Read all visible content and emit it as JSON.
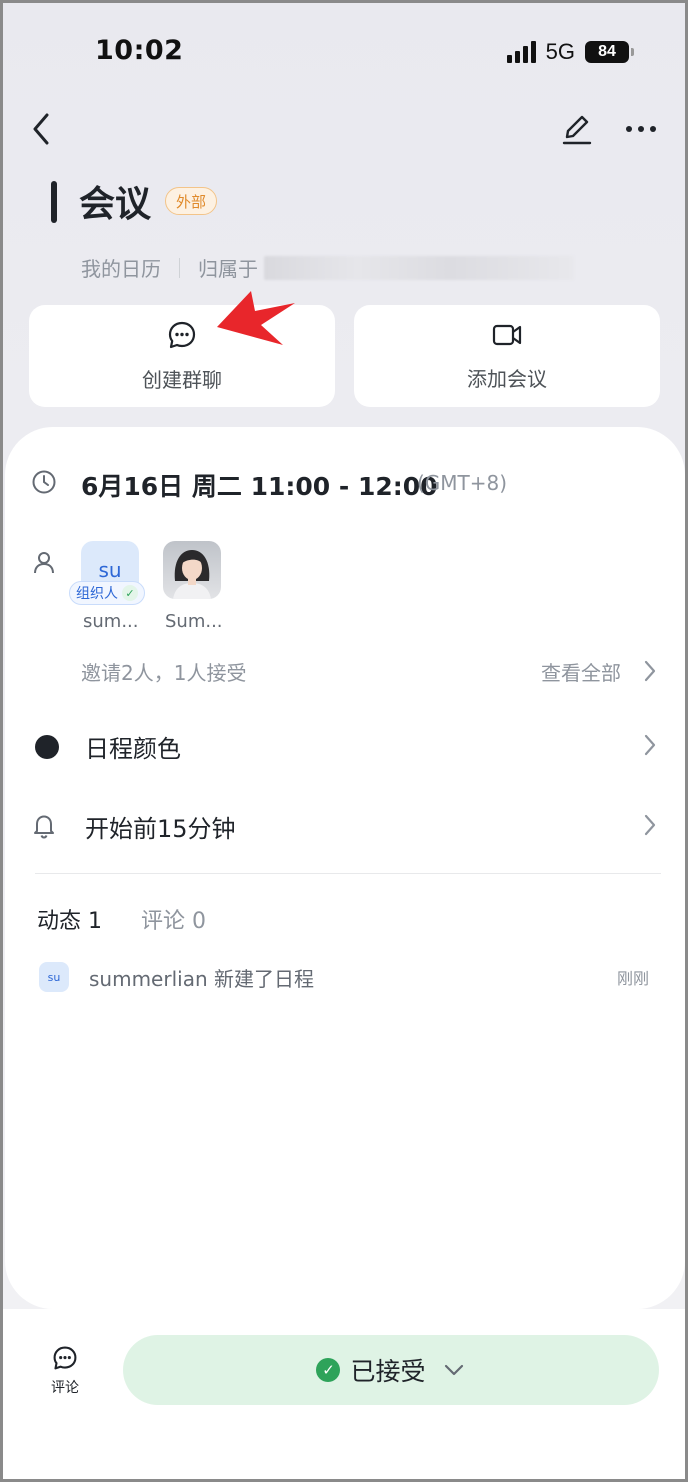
{
  "status_bar": {
    "time": "10:02",
    "network": "5G",
    "battery": "84"
  },
  "event": {
    "title": "会议",
    "external_tag": "外部",
    "calendar_name": "我的日历",
    "owner_label": "归属于"
  },
  "actions": {
    "create_group_chat": "创建群聊",
    "add_meeting": "添加会议"
  },
  "details": {
    "datetime": "6月16日 周二 11:00 - 12:00",
    "timezone": "(GMT+8)",
    "attendees": [
      {
        "avatar_text": "su",
        "name": "sum...",
        "badge": "组织人"
      },
      {
        "avatar_text": "",
        "name": "Sum..."
      }
    ],
    "invite_summary": "邀请2人，1人接受",
    "view_all": "查看全部",
    "color_label": "日程颜色",
    "reminder_label": "开始前15分钟"
  },
  "activity": {
    "tab_activity": "动态 1",
    "tab_comments": "评论 0",
    "items": [
      {
        "avatar_text": "su",
        "text": "summerlian 新建了日程",
        "time": "刚刚"
      }
    ]
  },
  "bottom_bar": {
    "comment_label": "评论",
    "rsvp_label": "已接受"
  },
  "colors": {
    "event_color": "#1f2329",
    "accept_bg": "#dff3e5",
    "accept_check": "#2ea35a",
    "external_tag": "#e08a2b",
    "annotation_arrow": "#e8262b"
  }
}
